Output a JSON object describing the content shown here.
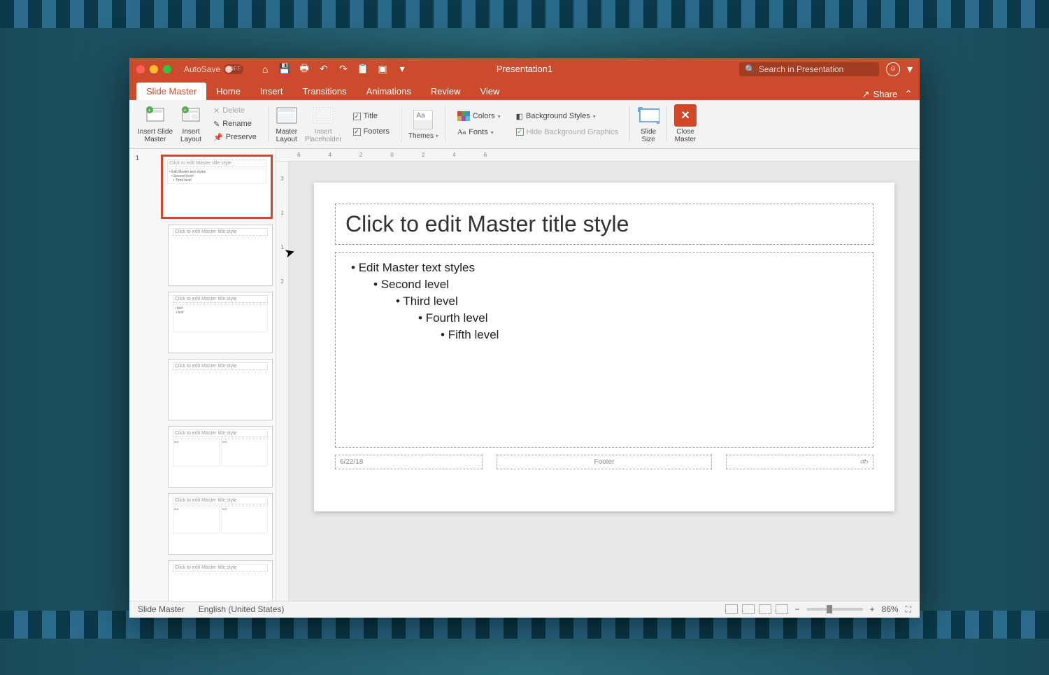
{
  "title": "Presentation1",
  "autosave": {
    "label": "AutoSave",
    "state": "OFF"
  },
  "search_placeholder": "Search in Presentation",
  "tabs": [
    "Slide Master",
    "Home",
    "Insert",
    "Transitions",
    "Animations",
    "Review",
    "View"
  ],
  "active_tab": "Slide Master",
  "share_label": "Share",
  "ribbon": {
    "insert_slide_master": "Insert Slide\nMaster",
    "insert_layout": "Insert\nLayout",
    "delete": "Delete",
    "rename": "Rename",
    "preserve": "Preserve",
    "master_layout": "Master\nLayout",
    "insert_placeholder": "Insert\nPlaceholder",
    "title": "Title",
    "footers": "Footers",
    "themes": "Themes",
    "colors": "Colors",
    "fonts": "Fonts",
    "background_styles": "Background Styles",
    "hide_bg": "Hide Background Graphics",
    "slide_size": "Slide\nSize",
    "close_master": "Close\nMaster"
  },
  "slide": {
    "title": "Click to edit Master title style",
    "levels": [
      "Edit Master text styles",
      "Second level",
      "Third level",
      "Fourth level",
      "Fifth level"
    ],
    "date": "6/22/18",
    "footer": "Footer",
    "pagenum": "‹#›"
  },
  "thumbs": {
    "num": "1",
    "tt": "Click to edit Master title style"
  },
  "status": {
    "view": "Slide Master",
    "lang": "English (United States)",
    "zoom": "86%"
  },
  "ruler_h": [
    "6",
    "4",
    "2",
    "0",
    "2",
    "4",
    "6"
  ],
  "ruler_v": [
    "3",
    "1",
    "1",
    "3"
  ]
}
